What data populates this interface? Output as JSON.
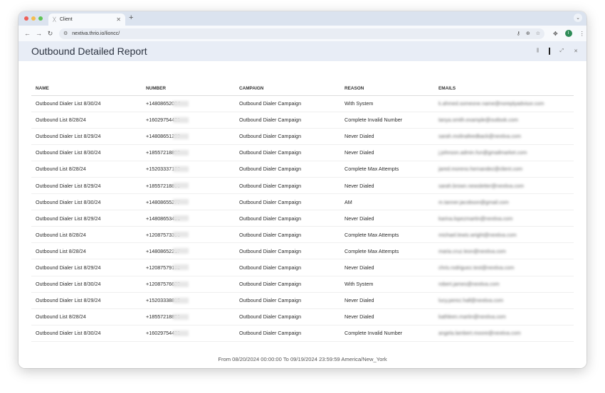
{
  "browser": {
    "tab_title": "Client",
    "url": "nextiva.thrio.io/lioncc/",
    "colors": {
      "close": "#ee5f57",
      "minimize": "#f4bd4f",
      "maximize": "#5fc454"
    },
    "avatar_letter": "I"
  },
  "report": {
    "title": "Outbound Detailed Report",
    "columns": [
      "NAME",
      "NUMBER",
      "CAMPAIGN",
      "REASON",
      "EMAILS"
    ],
    "rows": [
      {
        "name": "Outbound Dialer List 8/30/24",
        "number": "+14808652034",
        "campaign": "Outbound Dialer Campaign",
        "reason": "With System",
        "email": "k.ahmed.someone.name@noreplyadvisor.com"
      },
      {
        "name": "Outbound List 8/28/24",
        "number": "+16029754421",
        "campaign": "Outbound Dialer Campaign",
        "reason": "Complete Invalid Number",
        "email": "tanya.smith.example@outlook.com"
      },
      {
        "name": "Outbound Dialer List 8/29/24",
        "number": "+14808651239",
        "campaign": "Outbound Dialer Campaign",
        "reason": "Never Dialed",
        "email": "sarah.molinafeedback@nextiva.com"
      },
      {
        "name": "Outbound Dialer List 8/30/24",
        "number": "+18557218890",
        "campaign": "Outbound Dialer Campaign",
        "reason": "Never Dialed",
        "email": "j.johnson.admin.fun@gmailmarket.com"
      },
      {
        "name": "Outbound List 8/28/24",
        "number": "+15203337183",
        "campaign": "Outbound Dialer Campaign",
        "reason": "Complete Max Attempts",
        "email": "jared.moreno.hernandez@client.com"
      },
      {
        "name": "Outbound Dialer List 8/29/24",
        "number": "+18557218890",
        "campaign": "Outbound Dialer Campaign",
        "reason": "Never Dialed",
        "email": "sarah.brown.newsletter@nextiva.com"
      },
      {
        "name": "Outbound Dialer List 8/30/24",
        "number": "+14808655277",
        "campaign": "Outbound Dialer Campaign",
        "reason": "AM",
        "email": "m.tanner.jacobson@gmail.com"
      },
      {
        "name": "Outbound Dialer List 8/29/24",
        "number": "+14808653491",
        "campaign": "Outbound Dialer Campaign",
        "reason": "Never Dialed",
        "email": "karina.lopezmartin@nextiva.com"
      },
      {
        "name": "Outbound List 8/28/24",
        "number": "+12087573390",
        "campaign": "Outbound Dialer Campaign",
        "reason": "Complete Max Attempts",
        "email": "michael.lewis.wright@nextiva.com"
      },
      {
        "name": "Outbound List 8/28/24",
        "number": "+14808652217",
        "campaign": "Outbound Dialer Campaign",
        "reason": "Complete Max Attempts",
        "email": "maria.cruz.leon@nextiva.com"
      },
      {
        "name": "Outbound Dialer List 8/29/24",
        "number": "+12087579192",
        "campaign": "Outbound Dialer Campaign",
        "reason": "Never Dialed",
        "email": "chris.rodriguez.test@nextiva.com"
      },
      {
        "name": "Outbound Dialer List 8/30/24",
        "number": "+12087576620",
        "campaign": "Outbound Dialer Campaign",
        "reason": "With System",
        "email": "robert.james@nextiva.com"
      },
      {
        "name": "Outbound Dialer List 8/29/24",
        "number": "+15203338815",
        "campaign": "Outbound Dialer Campaign",
        "reason": "Never Dialed",
        "email": "lucy.perez.hall@nextiva.com"
      },
      {
        "name": "Outbound List 8/28/24",
        "number": "+18557218891",
        "campaign": "Outbound Dialer Campaign",
        "reason": "Never Dialed",
        "email": "kathleen.martin@nextiva.com"
      },
      {
        "name": "Outbound Dialer List 8/30/24",
        "number": "+16029754431",
        "campaign": "Outbound Dialer Campaign",
        "reason": "Complete Invalid Number",
        "email": "angela.lambert.moore@nextiva.com"
      }
    ],
    "footer": "From 08/20/2024 00:00:00 To 09/19/2024 23:59:59 America/New_York"
  }
}
